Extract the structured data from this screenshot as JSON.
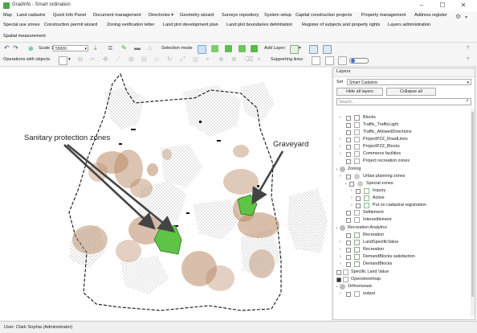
{
  "window": {
    "title": "GradInfo - Smart ordination"
  },
  "menu": {
    "row1": [
      "Map",
      "Land cadastre",
      "Quick Info Panel",
      "Document management",
      "Directories ▾",
      "Geometry wizard",
      "Surveys repository",
      "System setup",
      "Capital construction projects",
      "Property management",
      "Address register"
    ],
    "row2": [
      "Special use zones",
      "Construction permit wizard",
      "Zoning verification letter",
      "Land plot development plan",
      "Land plot boundaries delimitation",
      "Register of subjects and property rights",
      "Layers administration"
    ],
    "row3": [
      "Spatial measurement"
    ]
  },
  "toolbar": {
    "scale_label": "Scale 1:",
    "scale_value": "55000",
    "selection_mode_label": "Selection mode",
    "add_layer_label": "Add Layer:",
    "operations_label": "Operations with objects",
    "supporting_lines_label": "Supporting lines",
    "help_glyph": "?"
  },
  "layers_panel": {
    "header": "Layers",
    "set_label": "Set",
    "set_value": "Smart Cadastre",
    "hide_all_label": "Hide all layers",
    "collapse_all_label": "Collapse all",
    "search_placeholder": "Search...",
    "items": [
      "Blocks",
      "Traffic_TrafficLight",
      "Traffic_AllowedDirections",
      "ProjectPZZ_RoadLines",
      "ProjectPZZ_Blocks",
      "Commerce facilities",
      "Project recreation zones",
      "Zoning",
      "Urban planning zones",
      "Special zones",
      "Inquiry",
      "Active",
      "Put on cadastral registration",
      "Settlement",
      "Intersettlement",
      "Recreation Analytics",
      "Recreation",
      "LandSpecificValue",
      "Recreation",
      "DemandBlocks satisfaction",
      "DemandBlocks",
      "Specific Land Value",
      "Openstreetmap",
      "Orthomosaic",
      "output"
    ]
  },
  "annotations": {
    "sanitary": "Sanitary protection zones",
    "graveyard": "Graveyard"
  },
  "status": {
    "user": "User: Clark Sophia   (Administrator)"
  },
  "colors": {
    "zone_brown": "#b98a66",
    "graveyard_green": "#66cc4d",
    "window_bg": "#f0f0f0"
  }
}
